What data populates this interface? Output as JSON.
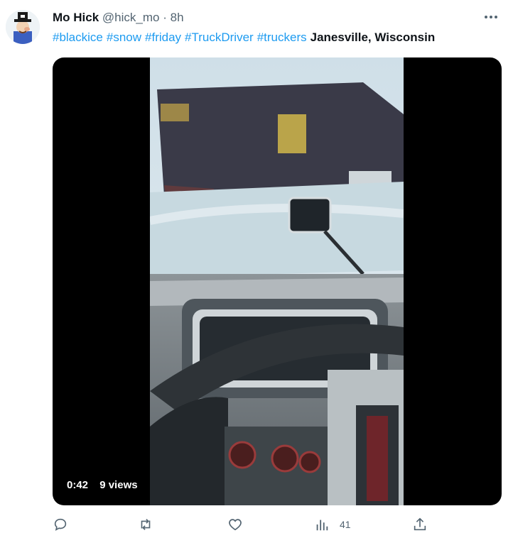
{
  "tweet": {
    "author_name": "Mo Hick",
    "handle": "@hick_mo",
    "separator": "·",
    "time": "8h",
    "hashtags": [
      "#blackice",
      "#snow",
      "#friday",
      "#TruckDriver",
      "#truckers"
    ],
    "location": "Janesville, Wisconsin"
  },
  "video": {
    "duration": "0:42",
    "views": "9 views"
  },
  "actions": {
    "reply_icon": "reply-icon",
    "retweet_icon": "retweet-icon",
    "like_icon": "heart-icon",
    "views_icon": "analytics-icon",
    "views_count": "41",
    "share_icon": "share-icon"
  },
  "colors": {
    "link": "#1d9bf0",
    "secondary_text": "#536471",
    "primary_text": "#0f1419"
  }
}
